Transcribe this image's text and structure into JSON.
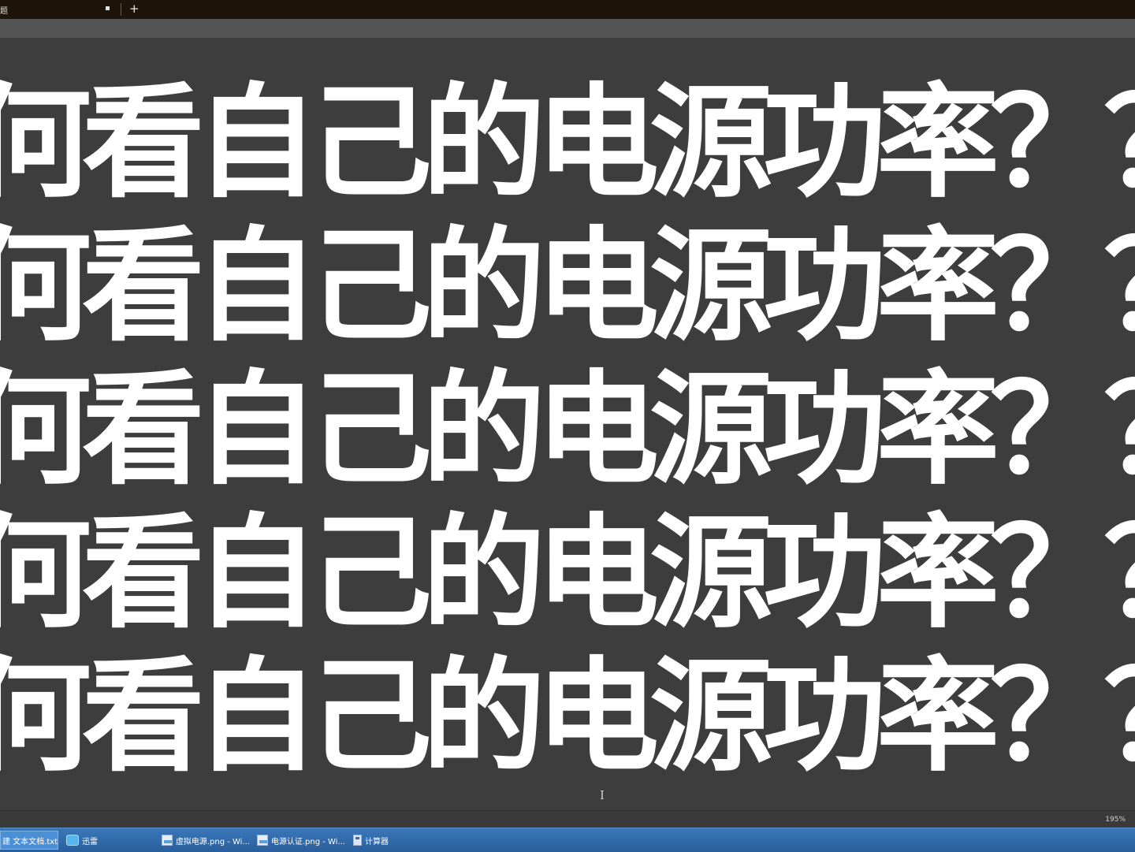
{
  "window": {
    "tab_title": "题",
    "new_tab_symbol": "+"
  },
  "editor": {
    "lines": [
      "何看自己的电源功率？？",
      "何看自己的电源功率？？",
      "何看自己的电源功率？？",
      "何看自己的电源功率？？",
      "何看自己的电源功率？？"
    ],
    "cursor_icon": "I-beam-cursor"
  },
  "statusbar": {
    "zoom": "195%"
  },
  "taskbar": {
    "items": [
      {
        "label": "建 文本文档.txt ...",
        "icon": "notepad-icon"
      },
      {
        "label": "迅雷",
        "icon": "bird-icon"
      },
      {
        "label": "虚拟电源.png - Wi...",
        "icon": "image-viewer-icon"
      },
      {
        "label": "电源认证.png - Wi...",
        "icon": "image-viewer-icon"
      },
      {
        "label": "计算器",
        "icon": "calculator-icon"
      }
    ]
  }
}
